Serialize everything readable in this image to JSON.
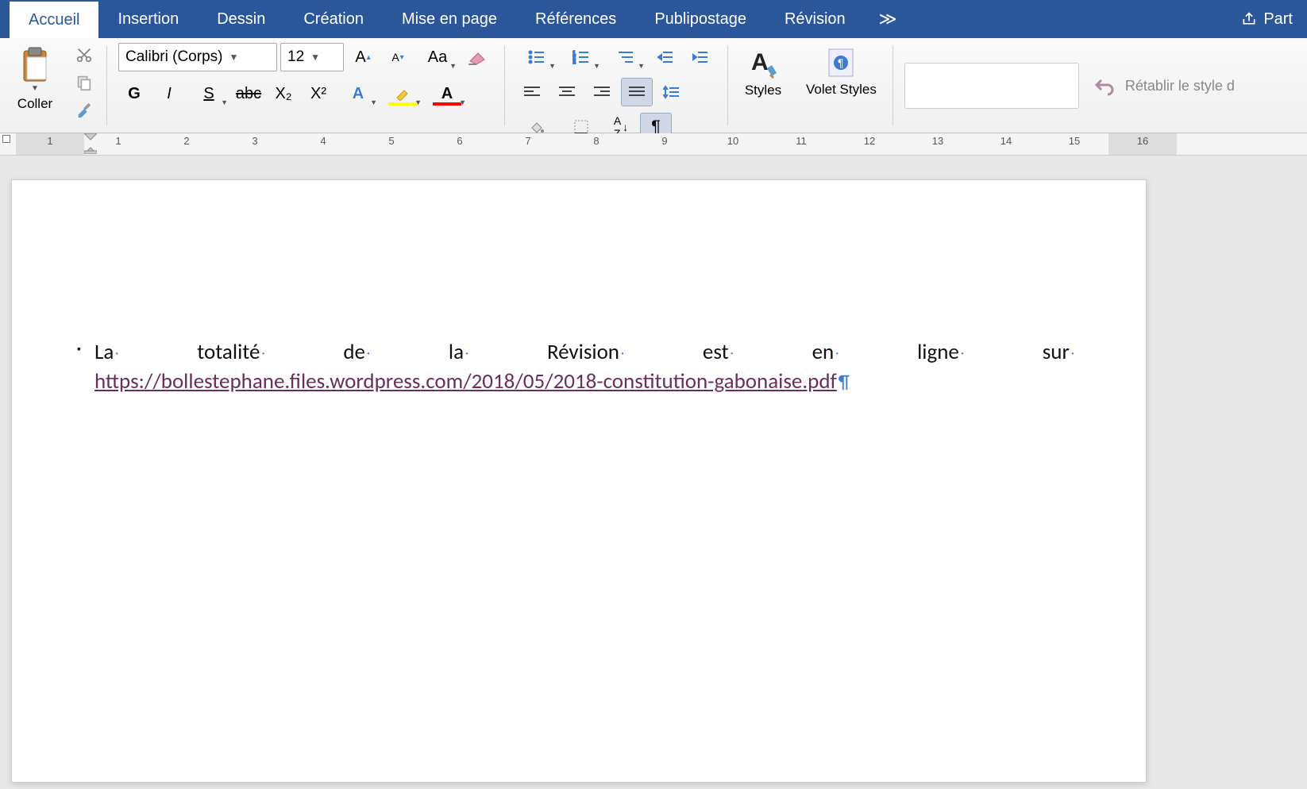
{
  "tabs": {
    "accueil": "Accueil",
    "insertion": "Insertion",
    "dessin": "Dessin",
    "creation": "Création",
    "mise_en_page": "Mise en page",
    "references": "Références",
    "publipostage": "Publipostage",
    "revision": "Révision",
    "more": "≫",
    "share": "Part"
  },
  "clipboard": {
    "paste_label": "Coller"
  },
  "font": {
    "name": "Calibri (Corps)",
    "size": "12",
    "bold": "G",
    "italic": "I",
    "underline": "S",
    "strike": "abc",
    "subscript": "X₂",
    "superscript": "X²",
    "grow": "A▴",
    "shrink": "A▾",
    "case": "Aa",
    "clear": "A",
    "text_effects": "A",
    "highlight": "A",
    "font_color": "A"
  },
  "styles": {
    "styles_label": "Styles",
    "pane_label": "Volet Styles"
  },
  "restore": {
    "label": "Rétablir le style d"
  },
  "ruler": {
    "numbers": [
      "1",
      "1",
      "2",
      "3",
      "4",
      "5",
      "6",
      "7",
      "8",
      "9",
      "10",
      "11",
      "12",
      "13",
      "14",
      "15",
      "16"
    ]
  },
  "document": {
    "words": [
      "La",
      "totalité",
      "de",
      "la",
      "Révision",
      "est",
      "en",
      "ligne",
      "sur"
    ],
    "link_text": "https://bollestephane.files.wordpress.com/2018/05/2018-constitution-gabonaise.pdf"
  }
}
